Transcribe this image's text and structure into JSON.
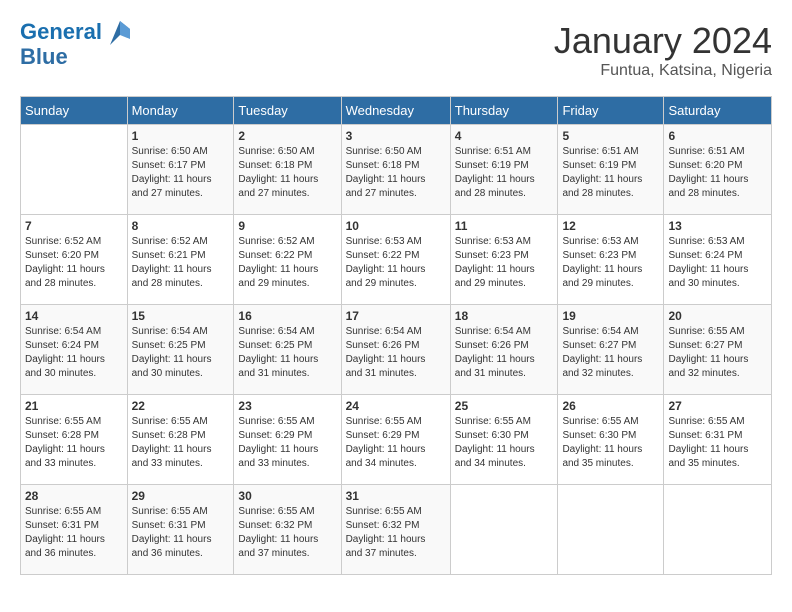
{
  "header": {
    "logo_line1": "General",
    "logo_line2": "Blue",
    "month_title": "January 2024",
    "location": "Funtua, Katsina, Nigeria"
  },
  "days_of_week": [
    "Sunday",
    "Monday",
    "Tuesday",
    "Wednesday",
    "Thursday",
    "Friday",
    "Saturday"
  ],
  "weeks": [
    [
      {
        "day": "",
        "info": ""
      },
      {
        "day": "1",
        "info": "Sunrise: 6:50 AM\nSunset: 6:17 PM\nDaylight: 11 hours\nand 27 minutes."
      },
      {
        "day": "2",
        "info": "Sunrise: 6:50 AM\nSunset: 6:18 PM\nDaylight: 11 hours\nand 27 minutes."
      },
      {
        "day": "3",
        "info": "Sunrise: 6:50 AM\nSunset: 6:18 PM\nDaylight: 11 hours\nand 27 minutes."
      },
      {
        "day": "4",
        "info": "Sunrise: 6:51 AM\nSunset: 6:19 PM\nDaylight: 11 hours\nand 28 minutes."
      },
      {
        "day": "5",
        "info": "Sunrise: 6:51 AM\nSunset: 6:19 PM\nDaylight: 11 hours\nand 28 minutes."
      },
      {
        "day": "6",
        "info": "Sunrise: 6:51 AM\nSunset: 6:20 PM\nDaylight: 11 hours\nand 28 minutes."
      }
    ],
    [
      {
        "day": "7",
        "info": "Sunrise: 6:52 AM\nSunset: 6:20 PM\nDaylight: 11 hours\nand 28 minutes."
      },
      {
        "day": "8",
        "info": "Sunrise: 6:52 AM\nSunset: 6:21 PM\nDaylight: 11 hours\nand 28 minutes."
      },
      {
        "day": "9",
        "info": "Sunrise: 6:52 AM\nSunset: 6:22 PM\nDaylight: 11 hours\nand 29 minutes."
      },
      {
        "day": "10",
        "info": "Sunrise: 6:53 AM\nSunset: 6:22 PM\nDaylight: 11 hours\nand 29 minutes."
      },
      {
        "day": "11",
        "info": "Sunrise: 6:53 AM\nSunset: 6:23 PM\nDaylight: 11 hours\nand 29 minutes."
      },
      {
        "day": "12",
        "info": "Sunrise: 6:53 AM\nSunset: 6:23 PM\nDaylight: 11 hours\nand 29 minutes."
      },
      {
        "day": "13",
        "info": "Sunrise: 6:53 AM\nSunset: 6:24 PM\nDaylight: 11 hours\nand 30 minutes."
      }
    ],
    [
      {
        "day": "14",
        "info": "Sunrise: 6:54 AM\nSunset: 6:24 PM\nDaylight: 11 hours\nand 30 minutes."
      },
      {
        "day": "15",
        "info": "Sunrise: 6:54 AM\nSunset: 6:25 PM\nDaylight: 11 hours\nand 30 minutes."
      },
      {
        "day": "16",
        "info": "Sunrise: 6:54 AM\nSunset: 6:25 PM\nDaylight: 11 hours\nand 31 minutes."
      },
      {
        "day": "17",
        "info": "Sunrise: 6:54 AM\nSunset: 6:26 PM\nDaylight: 11 hours\nand 31 minutes."
      },
      {
        "day": "18",
        "info": "Sunrise: 6:54 AM\nSunset: 6:26 PM\nDaylight: 11 hours\nand 31 minutes."
      },
      {
        "day": "19",
        "info": "Sunrise: 6:54 AM\nSunset: 6:27 PM\nDaylight: 11 hours\nand 32 minutes."
      },
      {
        "day": "20",
        "info": "Sunrise: 6:55 AM\nSunset: 6:27 PM\nDaylight: 11 hours\nand 32 minutes."
      }
    ],
    [
      {
        "day": "21",
        "info": "Sunrise: 6:55 AM\nSunset: 6:28 PM\nDaylight: 11 hours\nand 33 minutes."
      },
      {
        "day": "22",
        "info": "Sunrise: 6:55 AM\nSunset: 6:28 PM\nDaylight: 11 hours\nand 33 minutes."
      },
      {
        "day": "23",
        "info": "Sunrise: 6:55 AM\nSunset: 6:29 PM\nDaylight: 11 hours\nand 33 minutes."
      },
      {
        "day": "24",
        "info": "Sunrise: 6:55 AM\nSunset: 6:29 PM\nDaylight: 11 hours\nand 34 minutes."
      },
      {
        "day": "25",
        "info": "Sunrise: 6:55 AM\nSunset: 6:30 PM\nDaylight: 11 hours\nand 34 minutes."
      },
      {
        "day": "26",
        "info": "Sunrise: 6:55 AM\nSunset: 6:30 PM\nDaylight: 11 hours\nand 35 minutes."
      },
      {
        "day": "27",
        "info": "Sunrise: 6:55 AM\nSunset: 6:31 PM\nDaylight: 11 hours\nand 35 minutes."
      }
    ],
    [
      {
        "day": "28",
        "info": "Sunrise: 6:55 AM\nSunset: 6:31 PM\nDaylight: 11 hours\nand 36 minutes."
      },
      {
        "day": "29",
        "info": "Sunrise: 6:55 AM\nSunset: 6:31 PM\nDaylight: 11 hours\nand 36 minutes."
      },
      {
        "day": "30",
        "info": "Sunrise: 6:55 AM\nSunset: 6:32 PM\nDaylight: 11 hours\nand 37 minutes."
      },
      {
        "day": "31",
        "info": "Sunrise: 6:55 AM\nSunset: 6:32 PM\nDaylight: 11 hours\nand 37 minutes."
      },
      {
        "day": "",
        "info": ""
      },
      {
        "day": "",
        "info": ""
      },
      {
        "day": "",
        "info": ""
      }
    ]
  ]
}
